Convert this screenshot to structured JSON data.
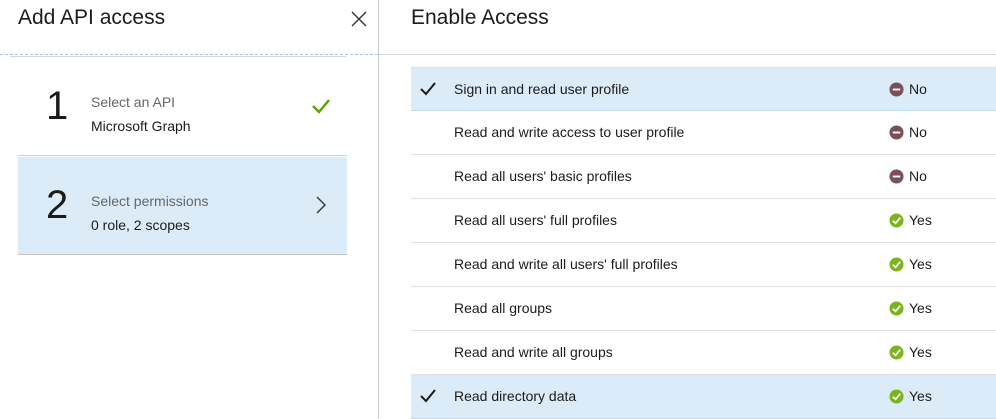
{
  "left_blade": {
    "title": "Add API access",
    "steps": [
      {
        "number": "1",
        "title": "Select an API",
        "subtitle": "Microsoft Graph",
        "state_icon": "checkmark-icon"
      },
      {
        "number": "2",
        "title": "Select permissions",
        "subtitle": "0 role, 2 scopes",
        "state_icon": "chevron-right-icon"
      }
    ]
  },
  "right_blade": {
    "title": "Enable Access",
    "permissions": [
      {
        "label": "Sign in and read user profile",
        "admin_required": "No",
        "checked": true
      },
      {
        "label": "Read and write access to user profile",
        "admin_required": "No",
        "checked": false
      },
      {
        "label": "Read all users' basic profiles",
        "admin_required": "No",
        "checked": false
      },
      {
        "label": "Read all users' full profiles",
        "admin_required": "Yes",
        "checked": false
      },
      {
        "label": "Read and write all users' full profiles",
        "admin_required": "Yes",
        "checked": false
      },
      {
        "label": "Read all groups",
        "admin_required": "Yes",
        "checked": false
      },
      {
        "label": "Read and write all groups",
        "admin_required": "Yes",
        "checked": false
      },
      {
        "label": "Read directory data",
        "admin_required": "Yes",
        "checked": true
      }
    ]
  },
  "colors": {
    "selected_bg": "#dcebf8",
    "check_green": "#57a300",
    "yes_green": "#7ab51d",
    "no_maroon": "#7a4f58"
  }
}
